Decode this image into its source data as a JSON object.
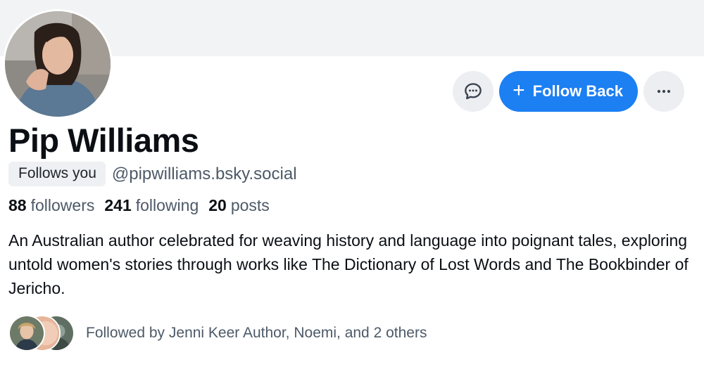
{
  "profile": {
    "display_name": "Pip Williams",
    "follows_you_badge": "Follows you",
    "handle": "@pipwilliams.bsky.social",
    "avatar_icon": "profile-avatar-photo"
  },
  "actions": {
    "message_icon": "chat-bubble-icon",
    "follow_plus": "+",
    "follow_label": "Follow Back",
    "more_icon": "ellipsis-icon"
  },
  "stats": {
    "followers_count": "88",
    "followers_label": "followers",
    "following_count": "241",
    "following_label": "following",
    "posts_count": "20",
    "posts_label": "posts"
  },
  "bio": "An Australian author celebrated for weaving history and language into poignant tales, exploring untold women's stories through works like The Dictionary of Lost Words and The Bookbinder of Jericho.",
  "followed_by": {
    "text": "Followed by Jenni Keer Author, Noemi, and 2 others"
  },
  "colors": {
    "accent": "#1c7ff2",
    "banner": "#f1f3f5",
    "secondary_text": "#4d5968",
    "badge_bg": "#eef0f3"
  }
}
